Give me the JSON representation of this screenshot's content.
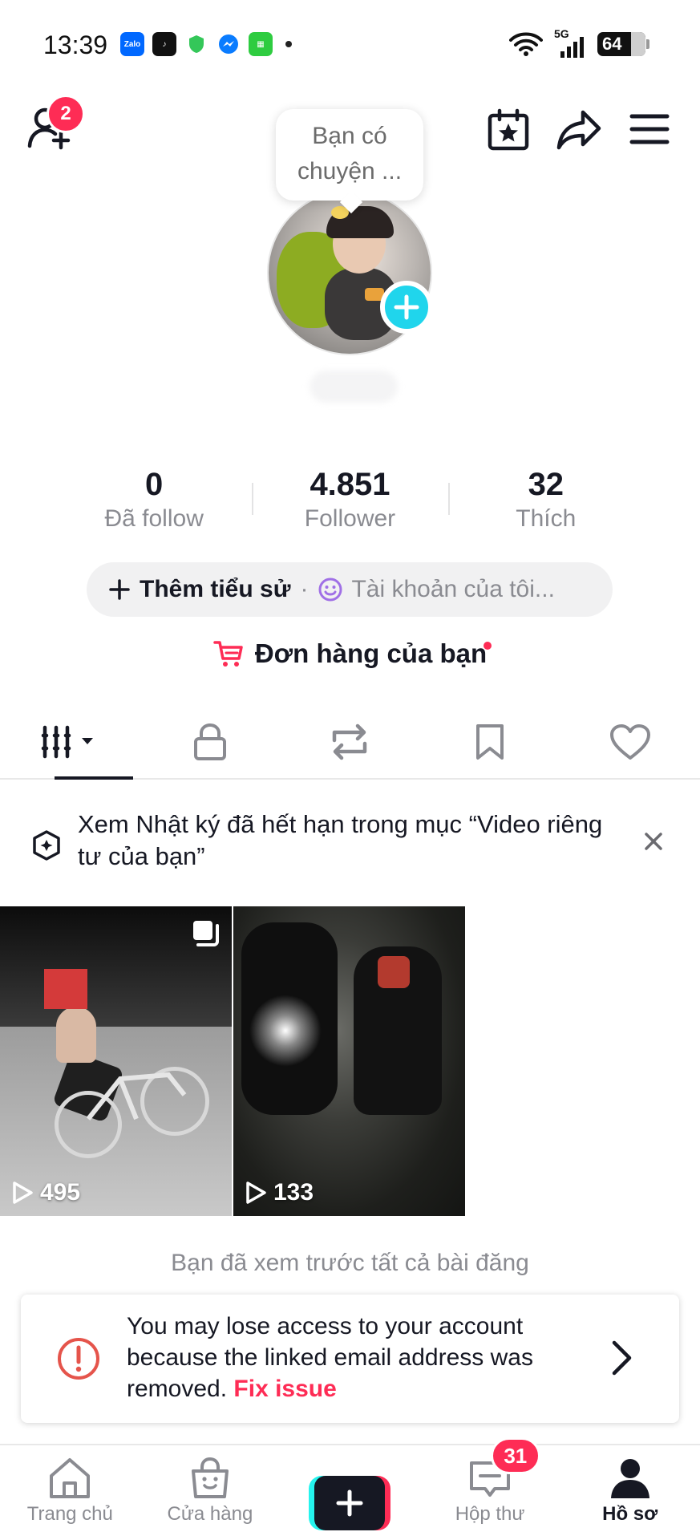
{
  "status_bar": {
    "time": "13:39",
    "apps": [
      "Zalo",
      "TikTok",
      "Shield",
      "Messenger",
      "Green app"
    ],
    "network": "5G",
    "battery": "64"
  },
  "header": {
    "friend_requests_badge": "2",
    "note_bubble": "Bạn có chuyện ..."
  },
  "stats": [
    {
      "value": "0",
      "label": "Đã follow"
    },
    {
      "value": "4.851",
      "label": "Follower"
    },
    {
      "value": "32",
      "label": "Thích"
    }
  ],
  "bio": {
    "add_label": "Thêm tiểu sử",
    "separator": "·",
    "account_placeholder": "Tài khoản của tôi..."
  },
  "orders": {
    "label": "Đơn hàng của bạn"
  },
  "archive_banner": {
    "text": "Xem Nhật ký đã hết hạn trong mục “Video riêng tư của bạn”"
  },
  "videos": [
    {
      "views": "495"
    },
    {
      "views": "133"
    }
  ],
  "end_message": "Bạn đã xem trước tất cả bài đăng",
  "warning": {
    "text": "You may lose access to your account because the linked email address was removed.",
    "fix_label": "Fix issue"
  },
  "bottom_nav": {
    "home": "Trang chủ",
    "shop": "Cửa hàng",
    "inbox": "Hộp thư",
    "inbox_badge": "31",
    "profile": "Hồ sơ"
  },
  "colors": {
    "accent": "#fe2c55",
    "cyan": "#20d5ec",
    "text": "#161823",
    "muted": "#8a8b91"
  }
}
